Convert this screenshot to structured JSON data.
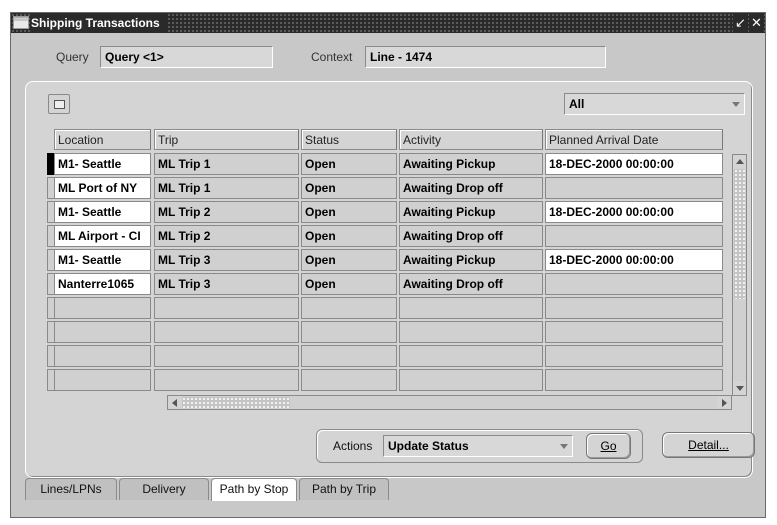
{
  "window": {
    "title": "Shipping Transactions",
    "controls": {
      "minimize": "⌄",
      "maximize": "↙",
      "close": "✕"
    }
  },
  "header": {
    "query_label": "Query",
    "query_value": "Query <1>",
    "context_label": "Context",
    "context_value": "Line - 1474"
  },
  "filter": {
    "selected": "All"
  },
  "table": {
    "columns": [
      "Location",
      "Trip",
      "Status",
      "Activity",
      "Planned Arrival Date"
    ],
    "rows": [
      {
        "location": "M1- Seattle",
        "trip": "ML Trip 1",
        "status": "Open",
        "activity": "Awaiting Pickup",
        "date": "18-DEC-2000 00:00:00"
      },
      {
        "location": "ML Port of NY",
        "trip": "ML Trip 1",
        "status": "Open",
        "activity": "Awaiting Drop off",
        "date": ""
      },
      {
        "location": "M1- Seattle",
        "trip": "ML Trip 2",
        "status": "Open",
        "activity": "Awaiting Pickup",
        "date": "18-DEC-2000 00:00:00"
      },
      {
        "location": "ML Airport - CI",
        "trip": "ML Trip 2",
        "status": "Open",
        "activity": "Awaiting Drop off",
        "date": ""
      },
      {
        "location": "M1- Seattle",
        "trip": "ML Trip 3",
        "status": "Open",
        "activity": "Awaiting Pickup",
        "date": "18-DEC-2000 00:00:00"
      },
      {
        "location": "Nanterre1065",
        "trip": "ML Trip 3",
        "status": "Open",
        "activity": "Awaiting Drop off",
        "date": ""
      }
    ]
  },
  "actions": {
    "label": "Actions",
    "selected": "Update Status",
    "go_label": "Go",
    "detail_label": "Detail..."
  },
  "tabs": [
    {
      "label": "Lines/LPNs"
    },
    {
      "label": "Delivery"
    },
    {
      "label": "Path by Stop"
    },
    {
      "label": "Path by Trip"
    }
  ]
}
